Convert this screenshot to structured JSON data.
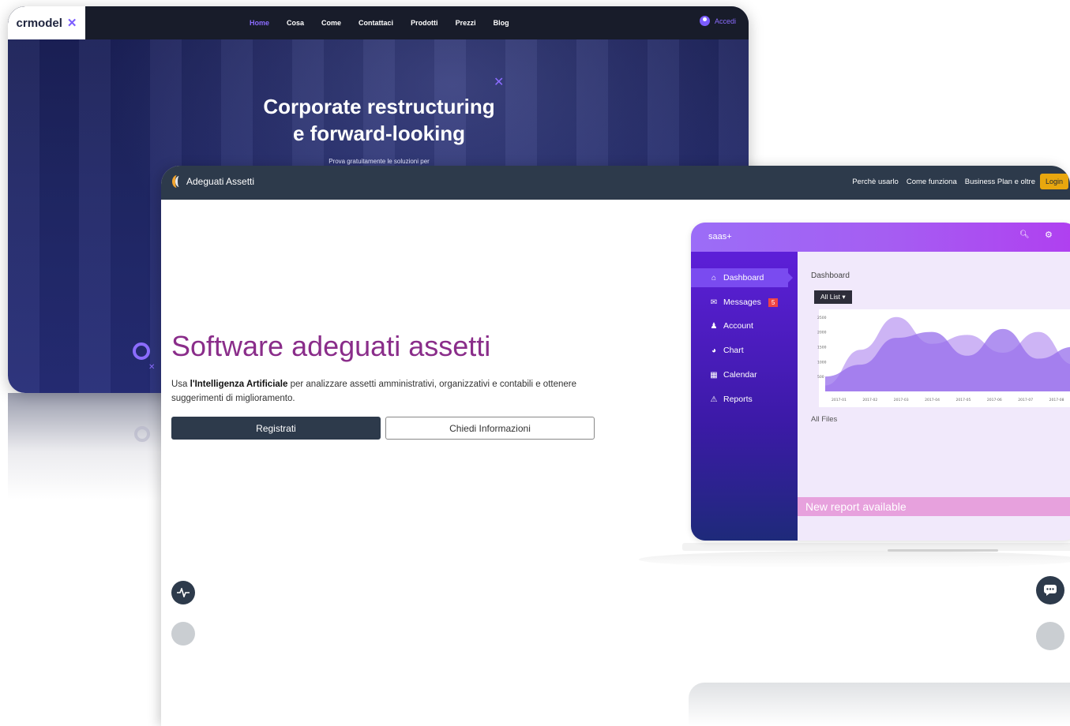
{
  "back_site": {
    "logo_text": "crmodel",
    "logo_mark": "✕",
    "nav": [
      "Home",
      "Cosa",
      "Come",
      "Contattaci",
      "Prodotti",
      "Prezzi",
      "Blog"
    ],
    "active_nav": "Home",
    "login_label": "Accedi",
    "hero_title_line1": "Corporate restructuring",
    "hero_title_line2": "e forward-looking",
    "hero_subtitle": "Prova gratuitamente le soluzioni per",
    "accent_color": "#7b5cff"
  },
  "front_site": {
    "brand": "Adeguati Assetti",
    "nav": [
      "Perchè usarlo",
      "Come funziona",
      "Business Plan e oltre"
    ],
    "login_label": "Login",
    "headline": "Software adeguati assetti",
    "description_pre": "Usa ",
    "description_bold": "l'Intelligenza Artificiale",
    "description_post": " per analizzare assetti amministrativi, organizzativi e contabili e ottenere suggerimenti di miglioramento.",
    "register_button": "Registrati",
    "info_button": "Chiedi Informazioni",
    "headline_color": "#8a2d8a",
    "dark_color": "#2d3a4b",
    "login_color": "#e8a70e"
  },
  "dashboard_mock": {
    "brand": "saas+",
    "sidebar": [
      {
        "label": "Dashboard",
        "icon": "home-icon",
        "badge": ""
      },
      {
        "label": "Messages",
        "icon": "mail-icon",
        "badge": "5"
      },
      {
        "label": "Account",
        "icon": "user-icon",
        "badge": ""
      },
      {
        "label": "Chart",
        "icon": "pie-icon",
        "badge": ""
      },
      {
        "label": "Calendar",
        "icon": "calendar-icon",
        "badge": ""
      },
      {
        "label": "Reports",
        "icon": "warning-icon",
        "badge": ""
      }
    ],
    "main_title": "Dashboard",
    "filter_label": "All List ▾",
    "files_label": "All Files",
    "banner": "New report available"
  },
  "chart_data": {
    "type": "area",
    "x": [
      "2017-01",
      "2017-02",
      "2017-03",
      "2017-04",
      "2017-05",
      "2017-06",
      "2017-07",
      "2017-08"
    ],
    "y_ticks": [
      "2500",
      "2000",
      "1500",
      "1000",
      "500"
    ],
    "series": [
      {
        "values": [
          200,
          1400,
          2500,
          1600,
          1900,
          1300,
          2000,
          900
        ]
      },
      {
        "values": [
          500,
          900,
          1800,
          2000,
          1200,
          2100,
          1100,
          1500
        ]
      }
    ],
    "ylim": [
      0,
      2600
    ]
  }
}
